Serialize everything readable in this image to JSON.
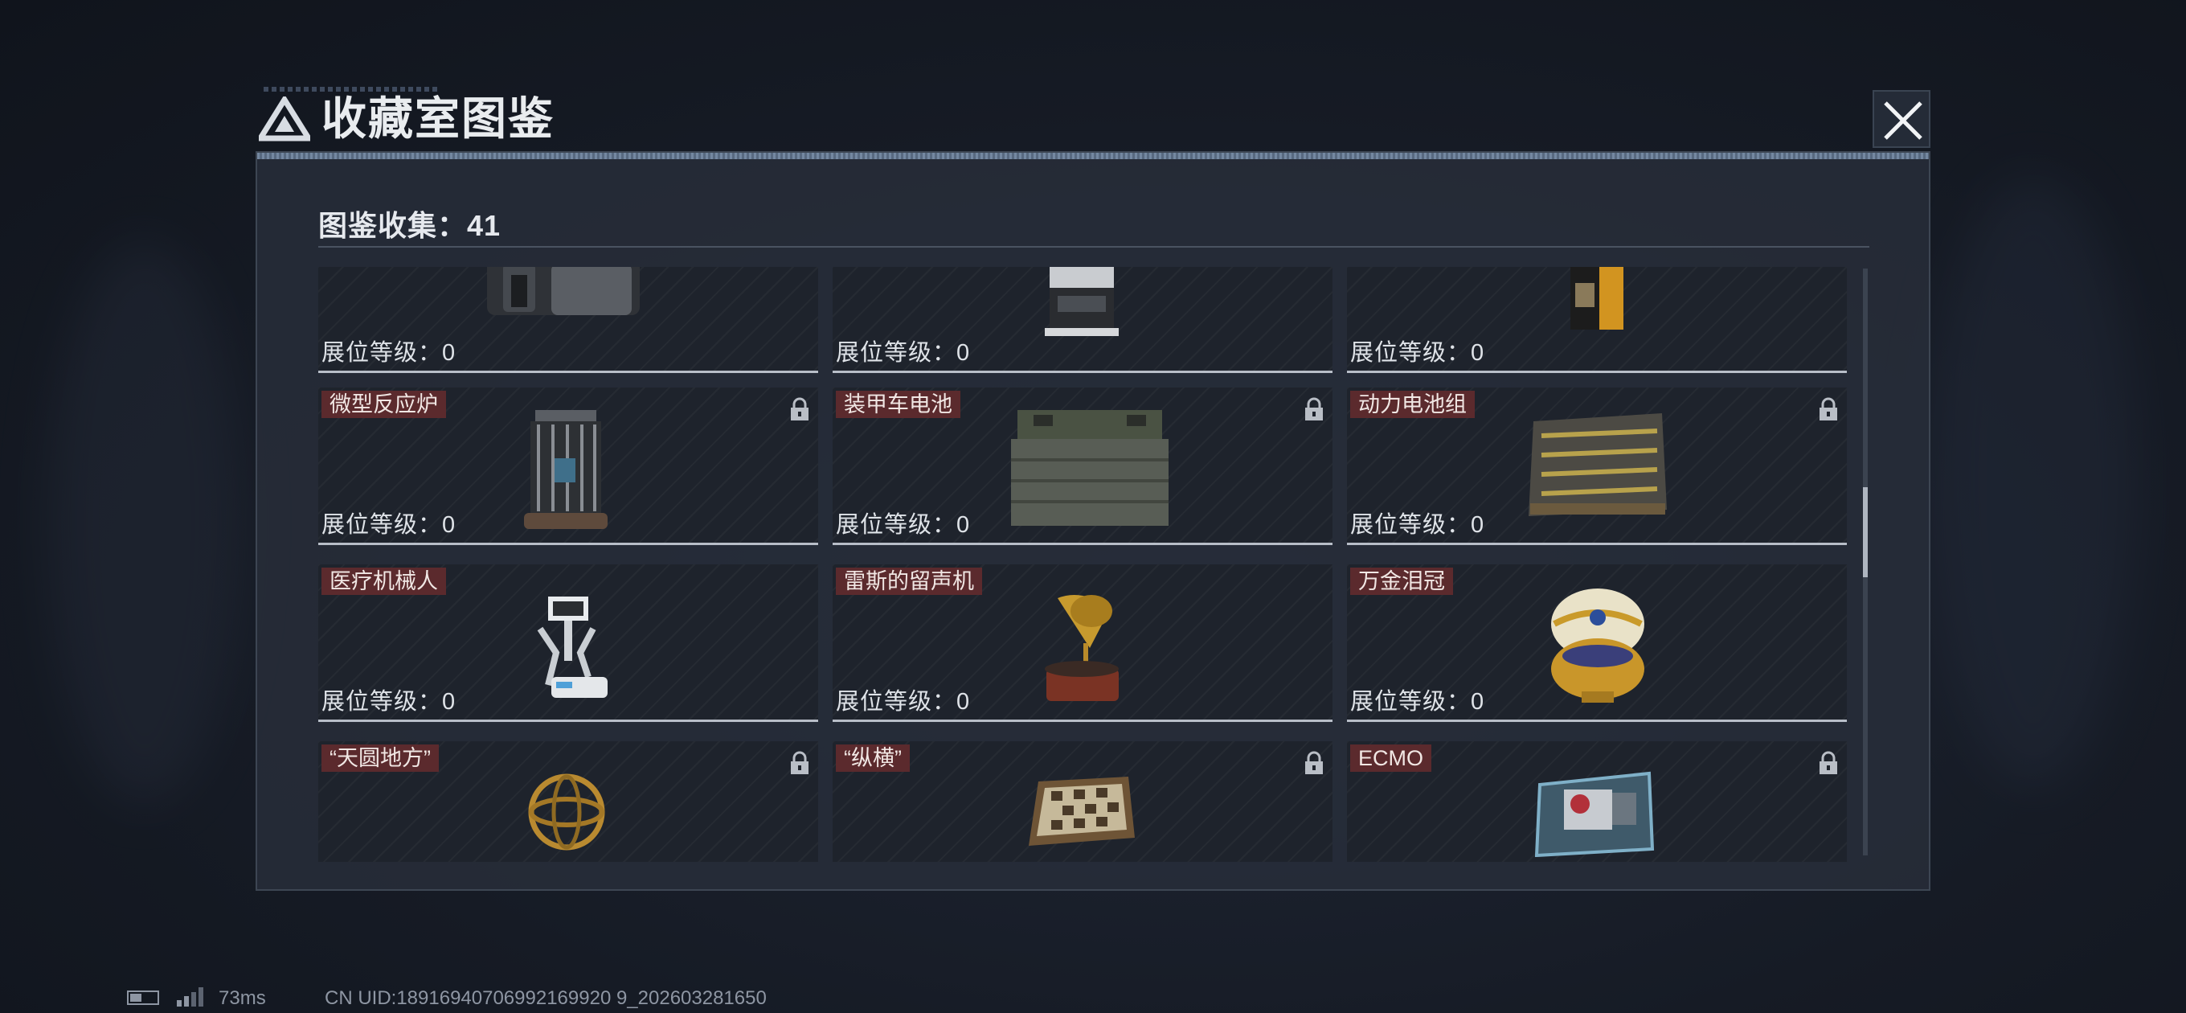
{
  "window": {
    "title": "收藏室图鉴",
    "close_icon": "close-icon"
  },
  "header": {
    "counter_label": "图鉴收集：41"
  },
  "items": [
    {
      "name": "",
      "level": "展位等级：0",
      "icon": "tactical-backpack",
      "locked": false
    },
    {
      "name": "",
      "level": "展位等级：0",
      "icon": "coffee-machine",
      "locked": false
    },
    {
      "name": "",
      "level": "展位等级：0",
      "icon": "coffee-bag",
      "locked": false
    },
    {
      "name": "微型反应炉",
      "level": "展位等级：0",
      "icon": "micro-reactor",
      "locked": true
    },
    {
      "name": "装甲车电池",
      "level": "展位等级：0",
      "icon": "armored-battery",
      "locked": true
    },
    {
      "name": "动力电池组",
      "level": "展位等级：0",
      "icon": "power-battery-pack",
      "locked": true
    },
    {
      "name": "医疗机械人",
      "level": "展位等级：0",
      "icon": "medical-robot",
      "locked": false
    },
    {
      "name": "雷斯的留声机",
      "level": "展位等级：0",
      "icon": "gramophone",
      "locked": false
    },
    {
      "name": "万金泪冠",
      "level": "展位等级：0",
      "icon": "jeweled-egg",
      "locked": false
    },
    {
      "name": "“天圆地方”",
      "level": "",
      "icon": "armillary-sphere",
      "locked": true
    },
    {
      "name": "“纵横”",
      "level": "",
      "icon": "chess-board",
      "locked": true
    },
    {
      "name": "ECMO",
      "level": "",
      "icon": "ecmo-machine",
      "locked": true
    }
  ],
  "status_bar": {
    "ping": "73ms",
    "uid": "CN UID:18916940706992169920 9_202603281650"
  },
  "colors": {
    "name_tag_bg": "#5b2a2d",
    "card_bg": "#1e232c",
    "panel_bg": "#282e3a"
  }
}
